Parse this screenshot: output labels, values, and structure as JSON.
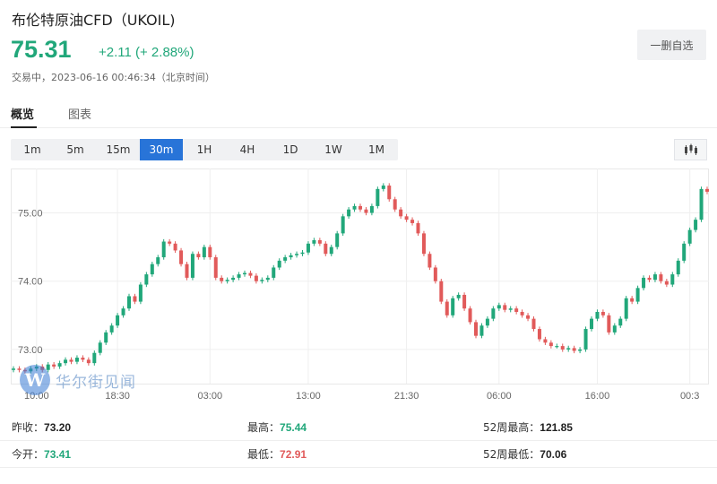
{
  "header": {
    "title": "布伦特原油CFD（UKOIL)",
    "price": "75.31",
    "change": "+2.11 (+ 2.88%)",
    "status": "交易中，2023-06-16 00:46:34（北京时间）",
    "watchlist_button": "一删自选"
  },
  "tabs": [
    {
      "label": "概览",
      "active": true
    },
    {
      "label": "图表",
      "active": false
    }
  ],
  "periods": [
    {
      "label": "1m",
      "active": false
    },
    {
      "label": "5m",
      "active": false
    },
    {
      "label": "15m",
      "active": false
    },
    {
      "label": "30m",
      "active": true
    },
    {
      "label": "1H",
      "active": false
    },
    {
      "label": "4H",
      "active": false
    },
    {
      "label": "1D",
      "active": false
    },
    {
      "label": "1W",
      "active": false
    },
    {
      "label": "1M",
      "active": false
    }
  ],
  "watermark": {
    "logo_letter": "W",
    "text": "华尔街见闻"
  },
  "colors": {
    "up": "#21a77a",
    "down": "#e15a5a",
    "accent": "#2874d8"
  },
  "chart_data": {
    "type": "candlestick",
    "interval": "30m",
    "ylim": [
      72.5,
      75.65
    ],
    "y_ticks": [
      {
        "value": 75.0,
        "label": "75.00"
      },
      {
        "value": 74.0,
        "label": "74.00"
      },
      {
        "value": 73.0,
        "label": "73.00"
      }
    ],
    "x_ticks": [
      {
        "index": 4,
        "label": "10:00"
      },
      {
        "index": 18,
        "label": "18:30"
      },
      {
        "index": 34,
        "label": "03:00"
      },
      {
        "index": 51,
        "label": "13:00"
      },
      {
        "index": 68,
        "label": "21:30"
      },
      {
        "index": 84,
        "label": "06:00"
      },
      {
        "index": 101,
        "label": "16:00"
      },
      {
        "index": 117,
        "label": "00:3"
      }
    ],
    "grid": true,
    "closes": [
      72.72,
      72.7,
      72.68,
      72.72,
      72.75,
      72.7,
      72.78,
      72.75,
      72.8,
      72.85,
      72.82,
      72.88,
      72.85,
      72.8,
      72.95,
      73.1,
      73.25,
      73.35,
      73.5,
      73.6,
      73.78,
      73.7,
      73.95,
      74.1,
      74.25,
      74.35,
      74.58,
      74.55,
      74.45,
      74.25,
      74.05,
      74.4,
      74.35,
      74.5,
      74.35,
      74.05,
      74.0,
      74.02,
      74.05,
      74.1,
      74.12,
      74.08,
      74.0,
      74.02,
      74.05,
      74.2,
      74.3,
      74.35,
      74.38,
      74.4,
      74.42,
      74.55,
      74.6,
      74.55,
      74.4,
      74.5,
      74.7,
      74.95,
      75.05,
      75.1,
      75.05,
      75.0,
      75.1,
      75.35,
      75.4,
      75.2,
      75.05,
      74.95,
      74.9,
      74.85,
      74.7,
      74.4,
      74.2,
      74.0,
      73.7,
      73.5,
      73.75,
      73.8,
      73.6,
      73.4,
      73.2,
      73.35,
      73.45,
      73.6,
      73.65,
      73.58,
      73.6,
      73.55,
      73.5,
      73.45,
      73.3,
      73.15,
      73.1,
      73.05,
      73.05,
      73.0,
      73.02,
      72.98,
      73.0,
      73.3,
      73.45,
      73.55,
      73.5,
      73.25,
      73.35,
      73.45,
      73.75,
      73.7,
      73.9,
      74.05,
      74.02,
      74.1,
      74.0,
      73.95,
      74.1,
      74.3,
      74.55,
      74.75,
      74.9,
      75.35,
      75.31
    ],
    "range": 0.1
  }
}
